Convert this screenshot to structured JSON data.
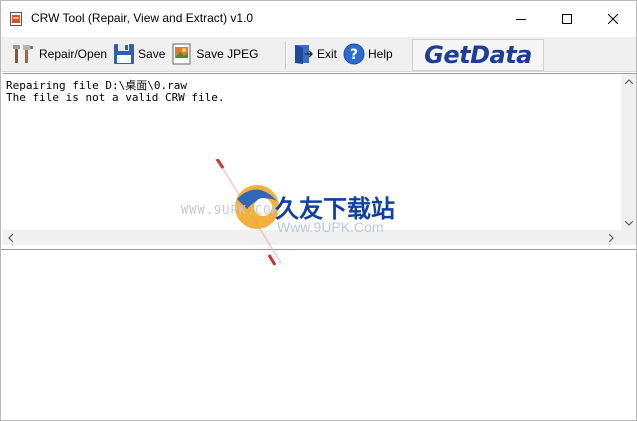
{
  "window": {
    "title": "CRW Tool (Repair, View and Extract) v1.0"
  },
  "toolbar": {
    "repair_open_label": "Repair/Open",
    "save_label": "Save",
    "save_jpeg_label": "Save JPEG",
    "exit_label": "Exit",
    "help_label": "Help",
    "logo_text": "GetData"
  },
  "log": {
    "lines": [
      "Repairing file D:\\桌面\\0.raw",
      "The file is not a valid CRW file."
    ]
  },
  "watermark": {
    "url": "WWW.9UPK.COM",
    "title": "久友下载站",
    "subtitle": "Www.9UPK.Com"
  },
  "colors": {
    "logo_blue": "#1e3c9a",
    "toolbar_bg": "#f0f0f0",
    "watermark_blue": "#0d3fa6"
  },
  "icons": {
    "app": "document-icon",
    "repair": "tools-icon",
    "save": "floppy-disk-icon",
    "save_jpeg": "image-file-icon",
    "exit": "exit-door-icon",
    "help": "help-question-icon"
  }
}
